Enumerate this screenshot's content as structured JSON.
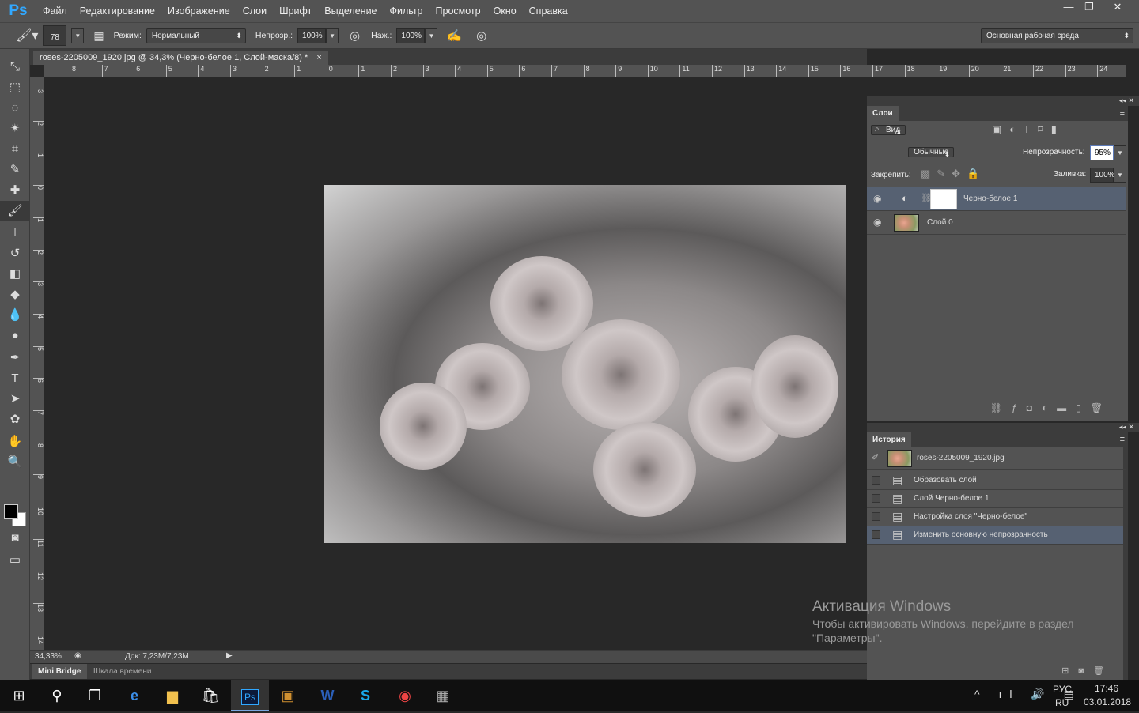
{
  "app": {
    "logo": "Ps",
    "menu": [
      "Файл",
      "Редактирование",
      "Изображение",
      "Слои",
      "Шрифт",
      "Выделение",
      "Фильтр",
      "Просмотр",
      "Окно",
      "Справка"
    ]
  },
  "window_controls": [
    "—",
    "❐",
    "✕"
  ],
  "options": {
    "brush_size": "78",
    "mode_label": "Режим:",
    "mode_value": "Нормальный",
    "opacity_label": "Непрозр.:",
    "opacity_value": "100%",
    "flow_label": "Наж.:",
    "flow_value": "100%",
    "workspace": "Основная рабочая среда"
  },
  "document": {
    "tab_title": "roses-2205009_1920.jpg @ 34,3% (Черно-белое 1, Слой-маска/8) *",
    "close": "×"
  },
  "rulers": {
    "h": [
      "8",
      "7",
      "6",
      "5",
      "4",
      "3",
      "2",
      "1",
      "0",
      "1",
      "2",
      "3",
      "4",
      "5",
      "6",
      "7",
      "8",
      "9",
      "10",
      "11",
      "12",
      "13",
      "14",
      "15",
      "16",
      "17",
      "18",
      "19",
      "20",
      "21",
      "22",
      "23",
      "24"
    ],
    "v": [
      "3",
      "2",
      "1",
      "0",
      "1",
      "2",
      "3",
      "4",
      "5",
      "6",
      "7",
      "8",
      "9",
      "10",
      "11",
      "12",
      "13",
      "14"
    ]
  },
  "tools": [
    {
      "icon": "move-icon",
      "g": "⤡"
    },
    {
      "icon": "marquee-icon",
      "g": "⬚"
    },
    {
      "icon": "lasso-icon",
      "g": "◌"
    },
    {
      "icon": "magic-wand-icon",
      "g": "✴"
    },
    {
      "icon": "crop-icon",
      "g": "⌗"
    },
    {
      "icon": "eyedropper-icon",
      "g": "✎"
    },
    {
      "icon": "healing-brush-icon",
      "g": "✚"
    },
    {
      "icon": "brush-icon",
      "g": "🖌"
    },
    {
      "icon": "stamp-icon",
      "g": "⊥"
    },
    {
      "icon": "history-brush-icon",
      "g": "↺"
    },
    {
      "icon": "eraser-icon",
      "g": "◧"
    },
    {
      "icon": "paint-bucket-icon",
      "g": "◆"
    },
    {
      "icon": "blur-icon",
      "g": "💧"
    },
    {
      "icon": "dodge-icon",
      "g": "●"
    },
    {
      "icon": "pen-icon",
      "g": "✒"
    },
    {
      "icon": "type-icon",
      "g": "T"
    },
    {
      "icon": "path-selection-icon",
      "g": "➤"
    },
    {
      "icon": "shape-icon",
      "g": "✿"
    },
    {
      "icon": "hand-icon",
      "g": "✋"
    },
    {
      "icon": "zoom-icon",
      "g": "🔍"
    }
  ],
  "status": {
    "zoom": "34,33%",
    "doc": "Док: 7,23M/7,23M"
  },
  "bottom_tabs": [
    "Mini Bridge",
    "Шкала времени"
  ],
  "layers": {
    "tab": "Слои",
    "filter": "Вид",
    "blend": "Обычные",
    "opacity_label": "Непрозрачность:",
    "opacity": "95%",
    "lock_label": "Закрепить:",
    "fill_label": "Заливка:",
    "fill": "100%",
    "items": [
      {
        "name": "Черно-белое 1",
        "selected": true
      },
      {
        "name": "Слой 0",
        "selected": false
      }
    ]
  },
  "history": {
    "tab": "История",
    "snapshot": "roses-2205009_1920.jpg",
    "items": [
      {
        "name": "Образовать слой",
        "selected": false
      },
      {
        "name": "Слой Черно-белое 1",
        "selected": false
      },
      {
        "name": "Настройка слоя \"Черно-белое\"",
        "selected": false
      },
      {
        "name": "Изменить основную непрозрачность",
        "selected": true
      }
    ]
  },
  "watermark": {
    "title": "Активация Windows",
    "line1": "Чтобы активировать Windows, перейдите в раздел",
    "line2": "\"Параметры\"."
  },
  "taskbar": {
    "lang1": "РУС",
    "lang2": "RU",
    "time": "17:46",
    "date": "03.01.2018"
  },
  "colors": {
    "accent": "#31a8ff",
    "selection": "#566172",
    "panel": "#535353",
    "canvas": "#282828"
  }
}
